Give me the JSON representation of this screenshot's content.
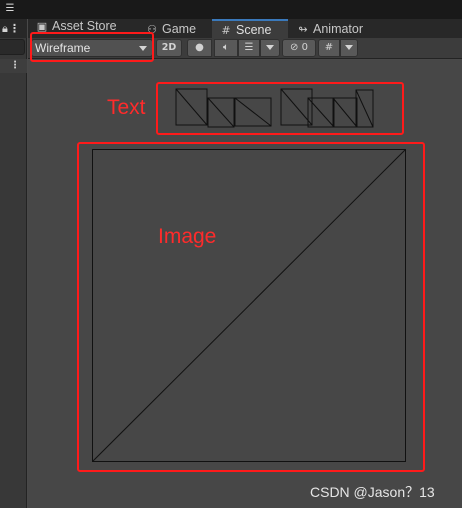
{
  "editor": {
    "tabs": [
      {
        "label": "Asset Store",
        "icon": "bag-icon"
      },
      {
        "label": "Game",
        "icon": "gamepad-icon"
      },
      {
        "label": "Scene",
        "icon": "grid-icon"
      },
      {
        "label": "Animator",
        "icon": "animator-icon"
      }
    ],
    "active_tab": "Scene",
    "accent_color": "#3a79bb"
  },
  "toolbar": {
    "draw_mode": "Wireframe",
    "mode_2d_label": "2D",
    "hidden_objects_count": "0"
  },
  "annotations": {
    "text_label": "Text",
    "image_label": "Image",
    "color": "#ff2b2b"
  },
  "watermark": "CSDN @Jason？13"
}
